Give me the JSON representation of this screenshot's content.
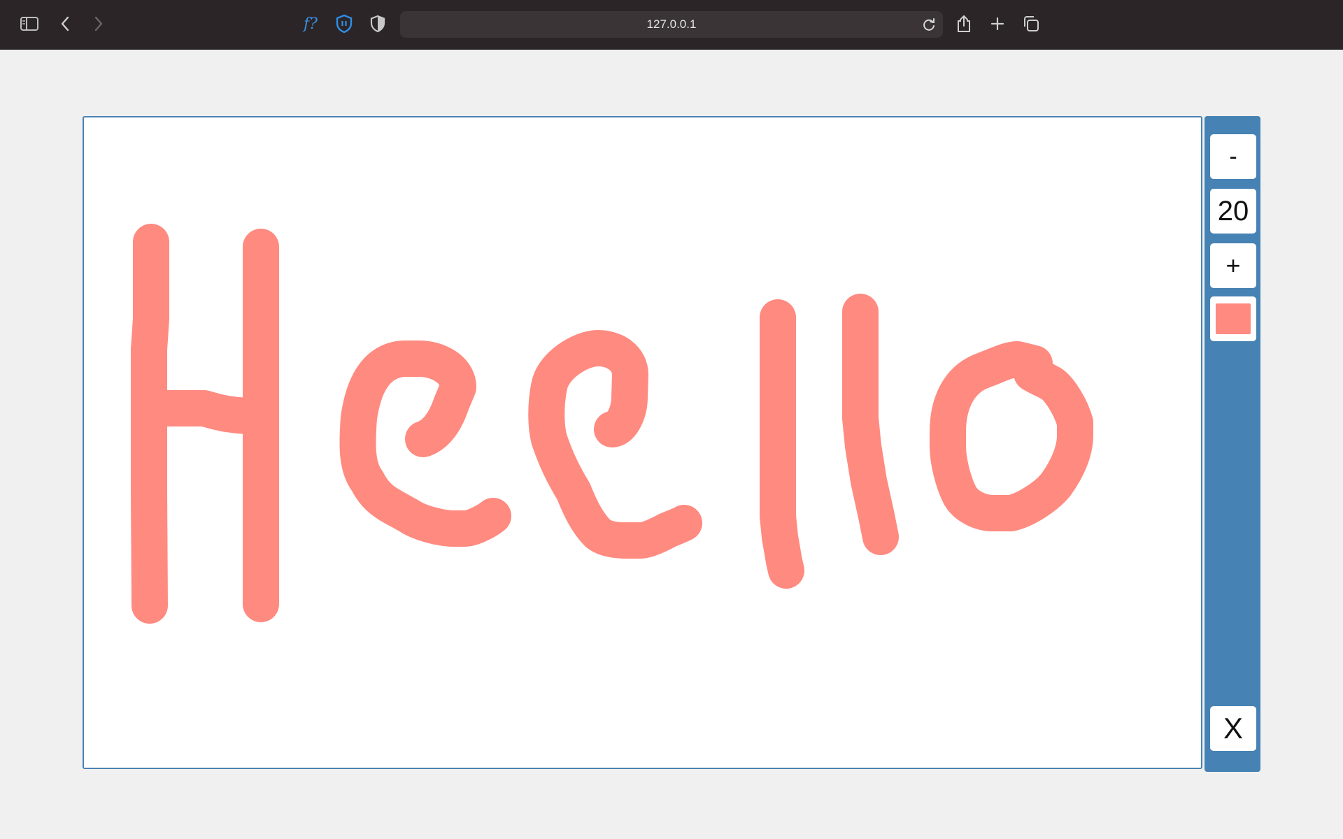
{
  "browser": {
    "url": "127.0.0.1",
    "icons": [
      "sidebar-icon",
      "back-icon",
      "forward-icon",
      "font-helper-icon",
      "privacy-shield-icon",
      "half-shield-icon",
      "reload-icon",
      "share-icon",
      "new-tab-icon",
      "tabs-overview-icon"
    ],
    "font_helper_label": "f?"
  },
  "drawing_panel": {
    "decrease_label": "-",
    "brush_size": "20",
    "increase_label": "+",
    "brush_color": "#ff8a80",
    "close_label": "X"
  },
  "colors": {
    "panel": "#4682b4",
    "canvas_border": "#4a82b4",
    "stroke": "#ff8a80",
    "toolbar": "#2b2527"
  }
}
